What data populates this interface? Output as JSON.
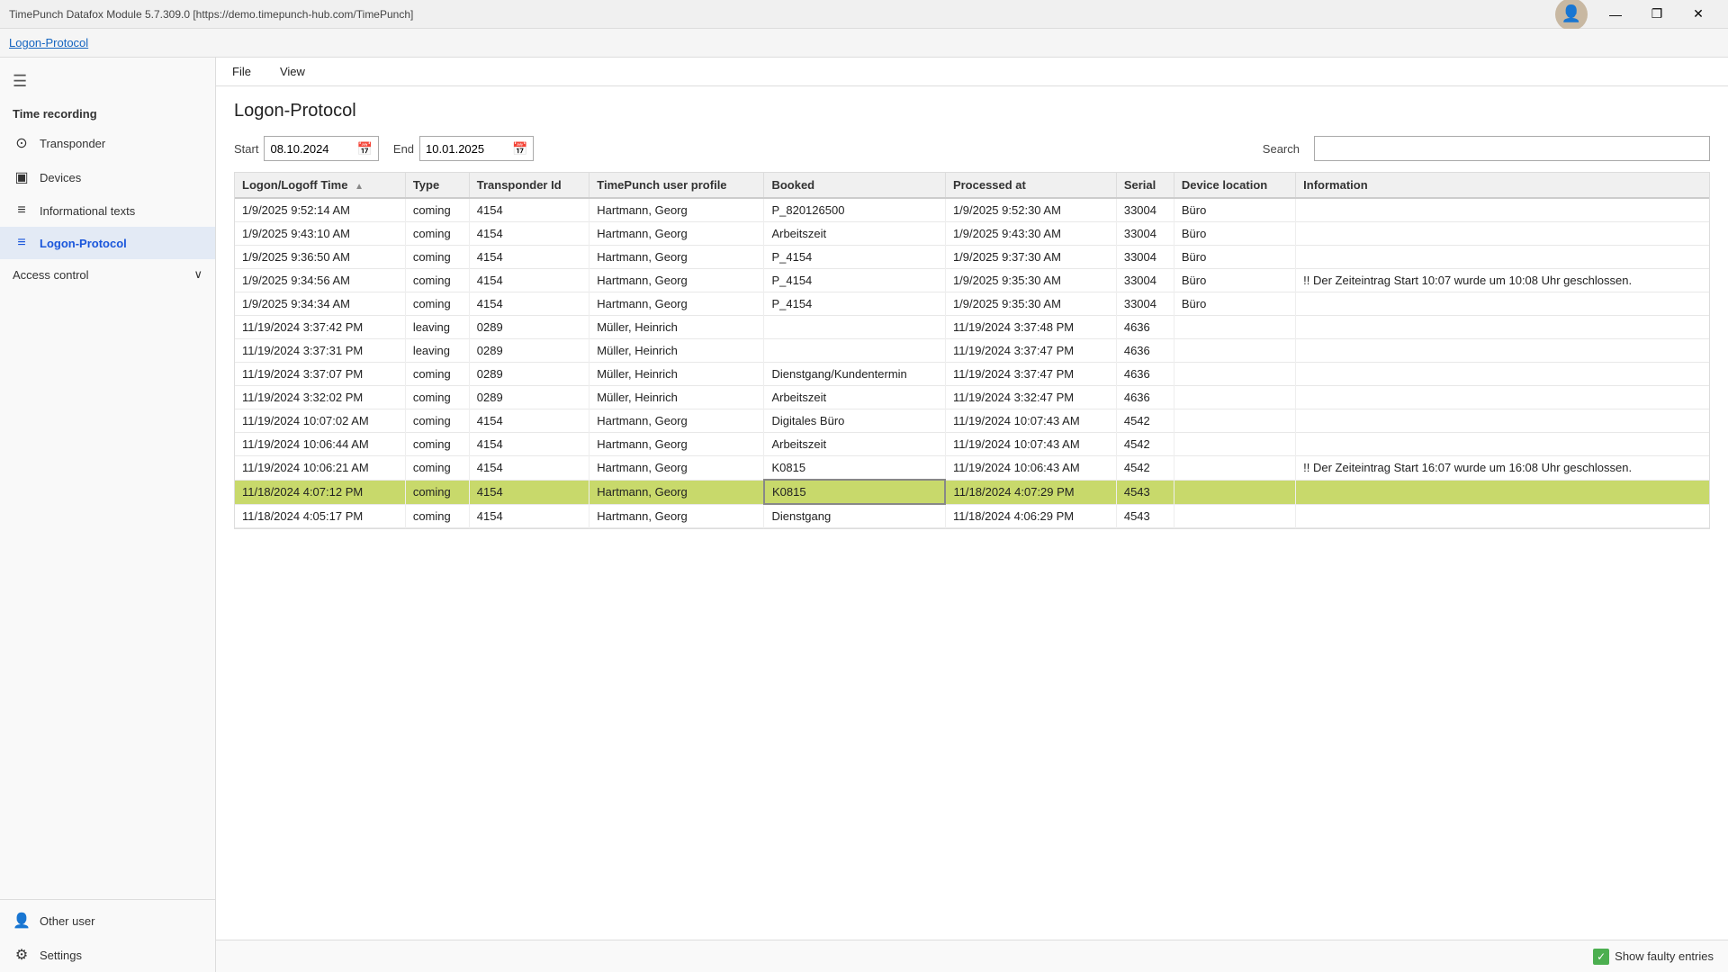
{
  "window": {
    "title": "TimePunch Datafox Module 5.7.309.0 [https://demo.timepunch-hub.com/TimePunch]"
  },
  "titlebar_controls": [
    "—",
    "❐",
    "✕"
  ],
  "topbar": {
    "link": "Logon-Protocol"
  },
  "sidebar": {
    "menu_icon": "☰",
    "section_time_recording": "Time recording",
    "items": [
      {
        "id": "transponder",
        "label": "Transponder",
        "icon": "⊙"
      },
      {
        "id": "devices",
        "label": "Devices",
        "icon": "▣"
      },
      {
        "id": "informational-texts",
        "label": "Informational texts",
        "icon": "≡"
      },
      {
        "id": "logon-protocol",
        "label": "Logon-Protocol",
        "icon": "≡"
      }
    ],
    "group_access_control": "Access control",
    "bottom_items": [
      {
        "id": "other-user",
        "label": "Other user",
        "icon": "👤"
      },
      {
        "id": "settings",
        "label": "Settings",
        "icon": "⚙"
      }
    ]
  },
  "menu_bar": {
    "items": [
      "File",
      "View"
    ]
  },
  "page": {
    "title": "Logon-Protocol"
  },
  "filters": {
    "start_label": "Start",
    "start_value": "08.10.2024",
    "end_label": "End",
    "end_value": "10.01.2025",
    "search_label": "Search",
    "search_placeholder": ""
  },
  "table": {
    "columns": [
      "Logon/Logoff Time",
      "Type",
      "Transponder Id",
      "TimePunch user profile",
      "Booked",
      "Processed at",
      "Serial",
      "Device location",
      "Information"
    ],
    "rows": [
      {
        "logon_time": "1/9/2025 9:52:14 AM",
        "type": "coming",
        "transponder_id": "4154",
        "user_profile": "Hartmann, Georg",
        "booked": "P_820126500",
        "processed_at": "1/9/2025 9:52:30 AM",
        "serial": "33004",
        "device_location": "Büro",
        "information": "",
        "selected": false
      },
      {
        "logon_time": "1/9/2025 9:43:10 AM",
        "type": "coming",
        "transponder_id": "4154",
        "user_profile": "Hartmann, Georg",
        "booked": "Arbeitszeit",
        "processed_at": "1/9/2025 9:43:30 AM",
        "serial": "33004",
        "device_location": "Büro",
        "information": "",
        "selected": false
      },
      {
        "logon_time": "1/9/2025 9:36:50 AM",
        "type": "coming",
        "transponder_id": "4154",
        "user_profile": "Hartmann, Georg",
        "booked": "P_4154",
        "processed_at": "1/9/2025 9:37:30 AM",
        "serial": "33004",
        "device_location": "Büro",
        "information": "",
        "selected": false
      },
      {
        "logon_time": "1/9/2025 9:34:56 AM",
        "type": "coming",
        "transponder_id": "4154",
        "user_profile": "Hartmann, Georg",
        "booked": "P_4154",
        "processed_at": "1/9/2025 9:35:30 AM",
        "serial": "33004",
        "device_location": "Büro",
        "information": "!! Der Zeiteintrag Start 10:07 wurde um 10:08 Uhr geschlossen.",
        "selected": false
      },
      {
        "logon_time": "1/9/2025 9:34:34 AM",
        "type": "coming",
        "transponder_id": "4154",
        "user_profile": "Hartmann, Georg",
        "booked": "P_4154",
        "processed_at": "1/9/2025 9:35:30 AM",
        "serial": "33004",
        "device_location": "Büro",
        "information": "",
        "selected": false
      },
      {
        "logon_time": "11/19/2024 3:37:42 PM",
        "type": "leaving",
        "transponder_id": "0289",
        "user_profile": "Müller, Heinrich",
        "booked": "",
        "processed_at": "11/19/2024 3:37:48 PM",
        "serial": "4636",
        "device_location": "",
        "information": "",
        "selected": false
      },
      {
        "logon_time": "11/19/2024 3:37:31 PM",
        "type": "leaving",
        "transponder_id": "0289",
        "user_profile": "Müller, Heinrich",
        "booked": "",
        "processed_at": "11/19/2024 3:37:47 PM",
        "serial": "4636",
        "device_location": "",
        "information": "",
        "selected": false
      },
      {
        "logon_time": "11/19/2024 3:37:07 PM",
        "type": "coming",
        "transponder_id": "0289",
        "user_profile": "Müller, Heinrich",
        "booked": "Dienstgang/Kundentermin",
        "processed_at": "11/19/2024 3:37:47 PM",
        "serial": "4636",
        "device_location": "",
        "information": "",
        "selected": false
      },
      {
        "logon_time": "11/19/2024 3:32:02 PM",
        "type": "coming",
        "transponder_id": "0289",
        "user_profile": "Müller, Heinrich",
        "booked": "Arbeitszeit",
        "processed_at": "11/19/2024 3:32:47 PM",
        "serial": "4636",
        "device_location": "",
        "information": "",
        "selected": false
      },
      {
        "logon_time": "11/19/2024 10:07:02 AM",
        "type": "coming",
        "transponder_id": "4154",
        "user_profile": "Hartmann, Georg",
        "booked": "Digitales Büro",
        "processed_at": "11/19/2024 10:07:43 AM",
        "serial": "4542",
        "device_location": "",
        "information": "",
        "selected": false
      },
      {
        "logon_time": "11/19/2024 10:06:44 AM",
        "type": "coming",
        "transponder_id": "4154",
        "user_profile": "Hartmann, Georg",
        "booked": "Arbeitszeit",
        "processed_at": "11/19/2024 10:07:43 AM",
        "serial": "4542",
        "device_location": "",
        "information": "",
        "selected": false
      },
      {
        "logon_time": "11/19/2024 10:06:21 AM",
        "type": "coming",
        "transponder_id": "4154",
        "user_profile": "Hartmann, Georg",
        "booked": "K0815",
        "processed_at": "11/19/2024 10:06:43 AM",
        "serial": "4542",
        "device_location": "",
        "information": "!! Der Zeiteintrag Start 16:07 wurde um 16:08 Uhr geschlossen.",
        "selected": false
      },
      {
        "logon_time": "11/18/2024 4:07:12 PM",
        "type": "coming",
        "transponder_id": "4154",
        "user_profile": "Hartmann, Georg",
        "booked": "K0815",
        "processed_at": "11/18/2024 4:07:29 PM",
        "serial": "4543",
        "device_location": "",
        "information": "",
        "selected": true
      },
      {
        "logon_time": "11/18/2024 4:05:17 PM",
        "type": "coming",
        "transponder_id": "4154",
        "user_profile": "Hartmann, Georg",
        "booked": "Dienstgang",
        "processed_at": "11/18/2024 4:06:29 PM",
        "serial": "4543",
        "device_location": "",
        "information": "",
        "selected": false
      }
    ]
  },
  "bottom_bar": {
    "show_faulty_label": "Show faulty entries"
  },
  "avatar_emoji": "👤"
}
